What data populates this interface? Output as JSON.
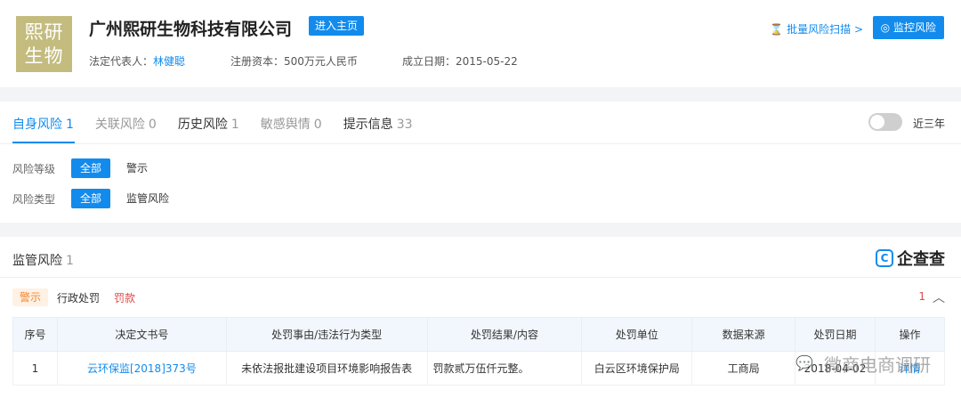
{
  "company": {
    "logo_line1": "熙研",
    "logo_line2": "生物",
    "name": "广州熙研生物科技有限公司",
    "enter_home": "进入主页",
    "legal_rep_label": "法定代表人：",
    "legal_rep": "林健聪",
    "capital_label": "注册资本：",
    "capital": "500万元人民币",
    "founded_label": "成立日期：",
    "founded": "2015-05-22",
    "batch_scan": "批量风险扫描 >",
    "monitor": "监控风险"
  },
  "tabs": [
    {
      "label": "自身风险",
      "count": "1"
    },
    {
      "label": "关联风险",
      "count": "0"
    },
    {
      "label": "历史风险",
      "count": "1"
    },
    {
      "label": "敏感舆情",
      "count": "0"
    },
    {
      "label": "提示信息",
      "count": "33"
    }
  ],
  "toggle_label": "近三年",
  "filters": {
    "level_label": "风险等级",
    "level_all": "全部",
    "level_warn": "警示",
    "type_label": "风险类型",
    "type_all": "全部",
    "type_regulatory": "监管风险"
  },
  "section": {
    "title": "监管风险",
    "count": "1",
    "brand": "企查查",
    "tag_warn": "警示",
    "tag_admin": "行政处罚",
    "tag_fine": "罚款",
    "right_count": "1"
  },
  "table": {
    "headers": [
      "序号",
      "决定文书号",
      "处罚事由/违法行为类型",
      "处罚结果/内容",
      "处罚单位",
      "数据来源",
      "处罚日期",
      "操作"
    ],
    "rows": [
      [
        "1",
        "云环保监[2018]373号",
        "未依法报批建设项目环境影响报告表",
        "罚款贰万伍仟元整。",
        "白云区环境保护局",
        "工商局",
        "2018-04-02",
        "详情"
      ]
    ]
  },
  "watermark": "微商电商调研",
  "colors": {
    "accent": "#128bed",
    "warn": "#f08934",
    "danger": "#e04a4a"
  }
}
